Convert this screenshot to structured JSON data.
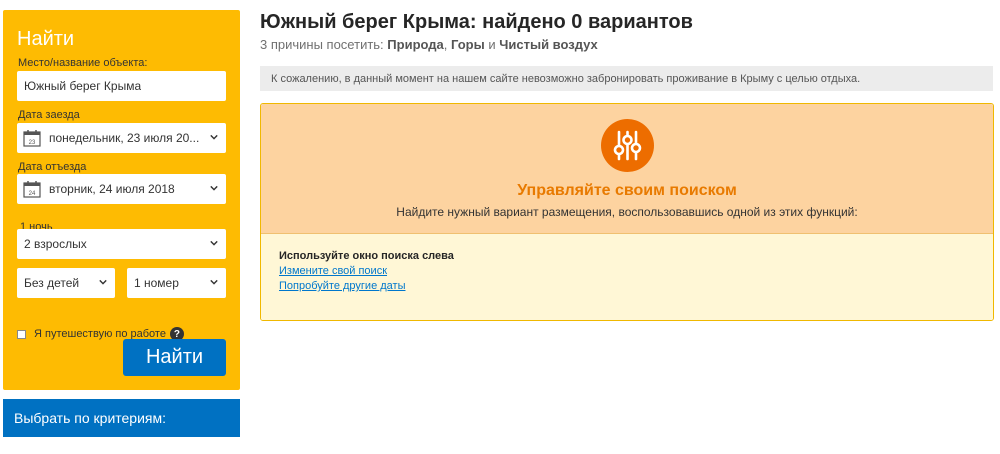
{
  "search": {
    "title": "Найти",
    "destination_label": "Место/название объекта:",
    "destination_value": "Южный берег Крыма",
    "checkin_label": "Дата заезда",
    "checkin_value": "понедельник, 23 июля 20...",
    "checkin_day": "23",
    "checkout_label": "Дата отъезда",
    "checkout_value": "вторник, 24 июля 2018",
    "checkout_day": "24",
    "nights": "1 ночь",
    "adults": "2 взрослых",
    "children": "Без детей",
    "rooms": "1 номер",
    "work_trip_label": "Я путешествую по работе",
    "help_glyph": "?",
    "submit_label": "Найти"
  },
  "criteria_bar": {
    "label": "Выбрать по критериям:"
  },
  "main": {
    "title": "Южный берег Крыма: найдено 0 вариантов",
    "reasons_prefix": "3 причины посетить:",
    "reason1": "Природа",
    "reason_sep1": ",",
    "reason2": "Горы",
    "reason_sep2": "и",
    "reason3": "Чистый воздух",
    "notice": "К сожалению, в данный момент на нашем сайте невозможно забронировать проживание в Крыму с целью отдыха."
  },
  "manage": {
    "title": "Управляйте своим поиском",
    "subtitle": "Найдите нужный вариант размещения, воспользовавшись одной из этих функций:",
    "tip_title": "Используйте окно поиска слева",
    "link1": "Измените свой поиск",
    "link2": "Попробуйте другие даты"
  },
  "icons": {
    "calendar": "calendar-icon",
    "chevron": "chevron-down-icon",
    "filters": "sliders-icon",
    "help": "help-icon"
  },
  "colors": {
    "search_bg": "#febb02",
    "primary_blue": "#0071c2",
    "manage_orange": "#ed6d00",
    "manage_bg": "#fdd3a0",
    "tips_bg": "#fff7d6",
    "link": "#0077cc"
  }
}
